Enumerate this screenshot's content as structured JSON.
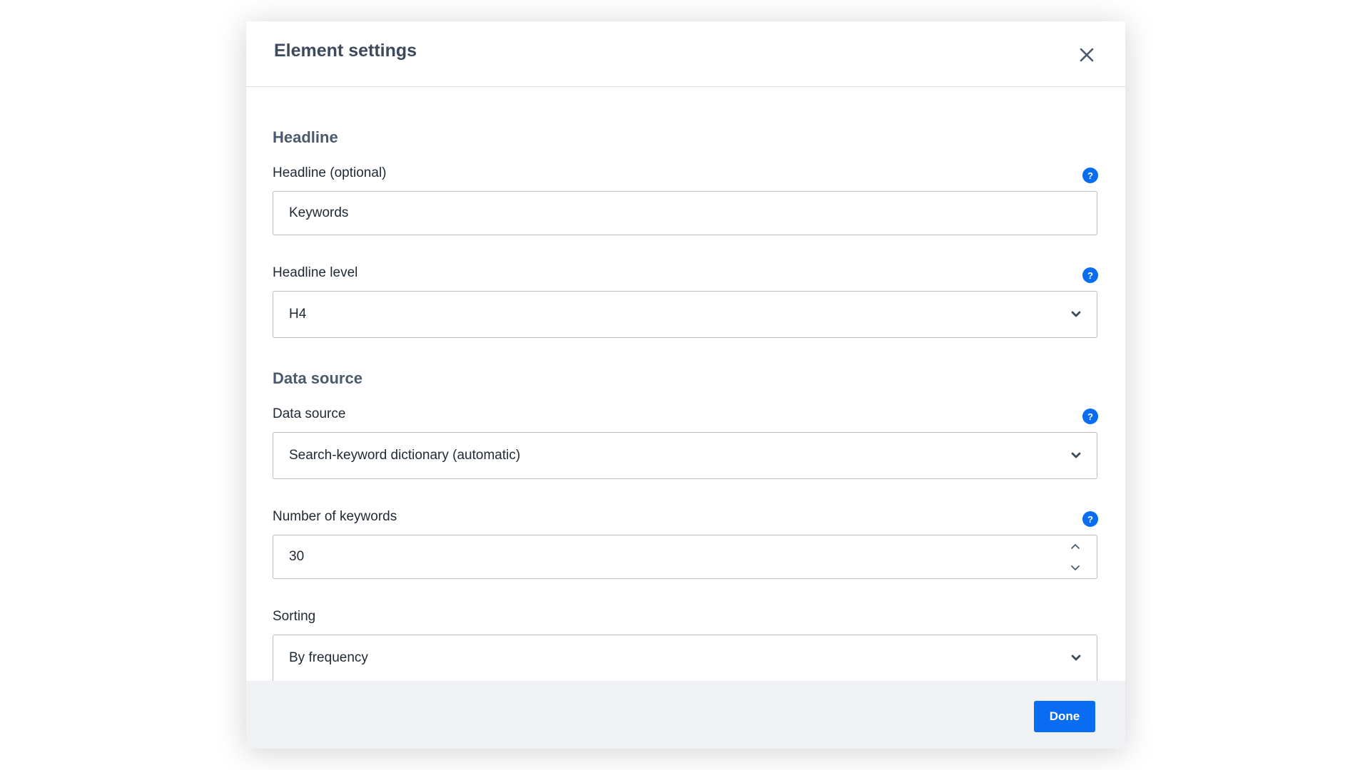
{
  "dialog": {
    "title": "Element settings",
    "close_icon": "close-icon"
  },
  "sections": {
    "headline": {
      "title": "Headline",
      "headline_field": {
        "label": "Headline (optional)",
        "value": "Keywords",
        "help": "?"
      },
      "level_field": {
        "label": "Headline level",
        "value": "H4",
        "help": "?"
      }
    },
    "data_source": {
      "title": "Data source",
      "source_field": {
        "label": "Data source",
        "value": "Search-keyword dictionary (automatic)",
        "help": "?"
      },
      "count_field": {
        "label": "Number of keywords",
        "value": "30",
        "help": "?"
      },
      "sorting_field": {
        "label": "Sorting",
        "value": "By frequency"
      }
    }
  },
  "footer": {
    "done_label": "Done"
  },
  "colors": {
    "accent": "#0a6cf0",
    "footer_bg": "#f0f2f5",
    "title": "#3b4a5c"
  }
}
